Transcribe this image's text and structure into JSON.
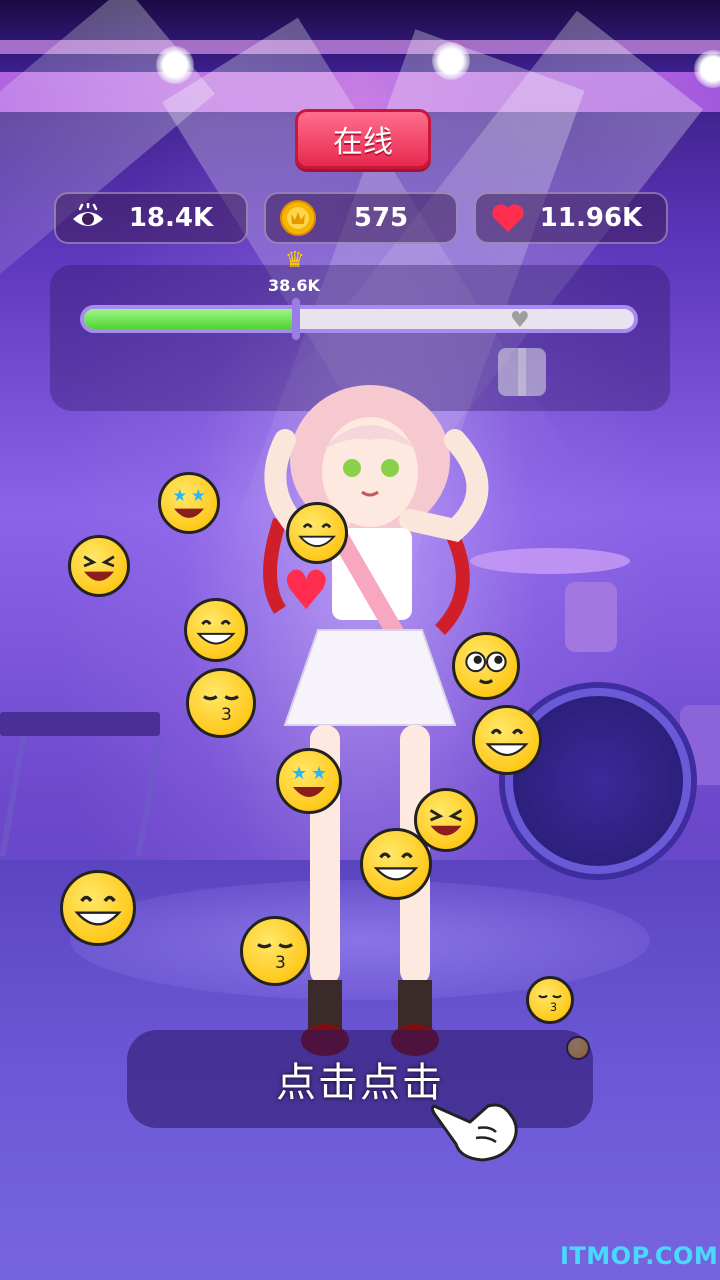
{
  "header": {
    "online_label": "在线"
  },
  "stats": {
    "views": {
      "icon": "eye-icon",
      "value": "18.4K"
    },
    "coins": {
      "icon": "coin-icon",
      "value": "575"
    },
    "likes": {
      "icon": "heart-icon",
      "value": "11.96K"
    }
  },
  "progress": {
    "milestone_label": "38.6K",
    "milestone_icon": "crown-icon",
    "fill_fraction": 0.39,
    "end_icon": "heart-icon",
    "reward_icon": "gift-icon"
  },
  "action": {
    "tap_label": "点击点击",
    "hand_icon": "pointing-hand-icon"
  },
  "watermark": "ITMOP.COM",
  "colors": {
    "accent_red": "#e8294f",
    "progress_green": "#52d330",
    "coin_gold": "#ffc91c"
  }
}
